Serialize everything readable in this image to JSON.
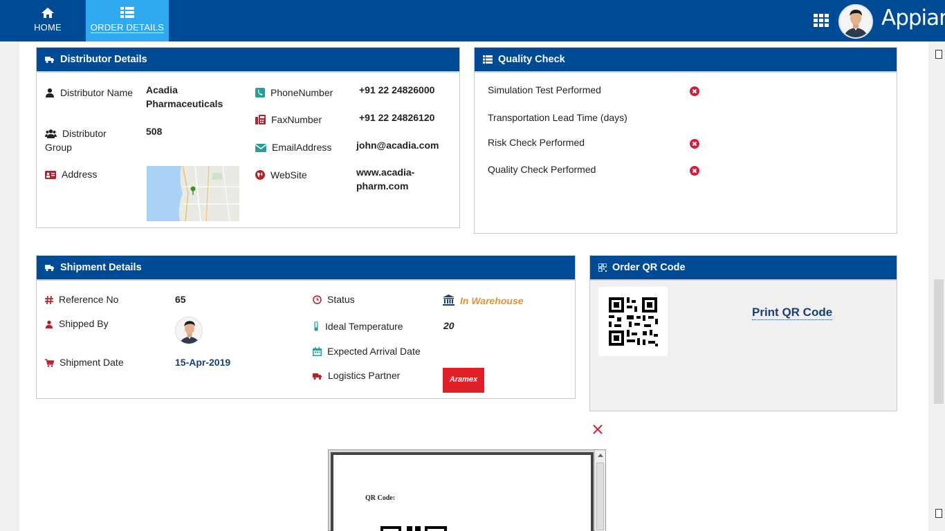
{
  "nav": {
    "home_label": "HOME",
    "order_label": "ORDER DETAILS",
    "brand": "Appian"
  },
  "distributor": {
    "title": "Distributor Details",
    "name_label": "Distributor Name",
    "name_value": "Acadia Pharmaceuticals",
    "group_label": "Distributor Group",
    "group_value": "508",
    "address_label": "Address",
    "phone_label": "PhoneNumber",
    "phone_value": "+91 22 24826000",
    "fax_label": "FaxNumber",
    "fax_value": "+91 22 24826120",
    "email_label": "EmailAddress",
    "email_value": "john@acadia.com",
    "website_label": "WebSite",
    "website_value": "www.acadia-pharm.com"
  },
  "quality": {
    "title": "Quality Check",
    "items": [
      {
        "label": "Simulation Test Performed",
        "failed": true
      },
      {
        "label": "Transportation Lead Time (days)",
        "failed": false
      },
      {
        "label": "Risk Check Performed",
        "failed": true
      },
      {
        "label": "Quality Check Performed",
        "failed": true
      }
    ]
  },
  "shipment": {
    "title": "Shipment Details",
    "ref_label": "Reference No",
    "ref_value": "65",
    "shipped_by_label": "Shipped By",
    "date_label": "Shipment Date",
    "date_value": "15-Apr-2019",
    "status_label": "Status",
    "status_value": "In Warehouse",
    "temp_label": "Ideal Temperature",
    "temp_value": "20",
    "arrival_label": "Expected Arrival Date",
    "arrival_value": "",
    "partner_label": "Logistics Partner",
    "partner_logo_text": "Aramex"
  },
  "qr": {
    "title": "Order QR Code",
    "print_label": "Print QR Code",
    "preview_label": "QR Code:"
  },
  "colors": {
    "brand_blue": "#004b96",
    "active_tab": "#2fa9f0",
    "icon_red": "#b5222d",
    "status_orange": "#e8912d",
    "error_red": "#d11f3b"
  }
}
